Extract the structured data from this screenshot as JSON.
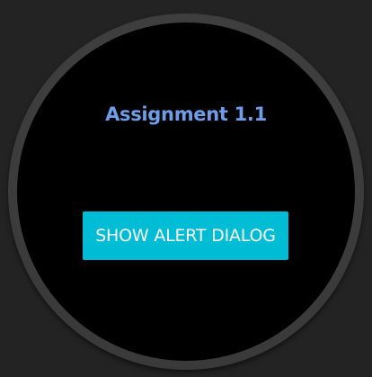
{
  "app": {
    "title": "Assignment 1.1"
  },
  "main": {
    "button_label": "SHOW ALERT DIALOG"
  },
  "colors": {
    "background": "#232323",
    "screen": "#000000",
    "title": "#6d9eea",
    "button": "#00bcd4",
    "button_text": "#ffffff"
  }
}
